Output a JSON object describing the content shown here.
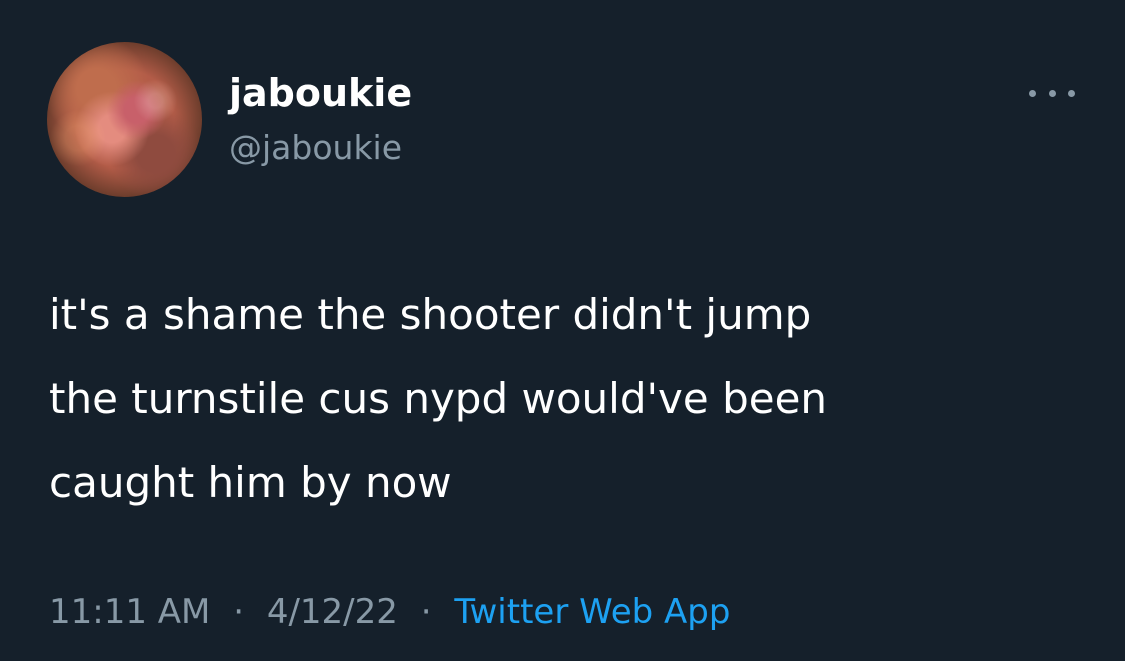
{
  "tweet": {
    "author": {
      "display_name": "jaboukie",
      "handle": "@jaboukie",
      "avatar_icon": "user-avatar"
    },
    "more_icon": "more-options-icon",
    "text": "it's a shame the shooter didn't jump\nthe turnstile cus nypd would've been\ncaught him by now",
    "time": "11:11 AM",
    "separator": "·",
    "date": "4/12/22",
    "source": "Twitter Web App",
    "colors": {
      "background": "#15202b",
      "primary_text": "#ffffff",
      "secondary_text": "#8899a6",
      "accent": "#1da1f2"
    }
  }
}
